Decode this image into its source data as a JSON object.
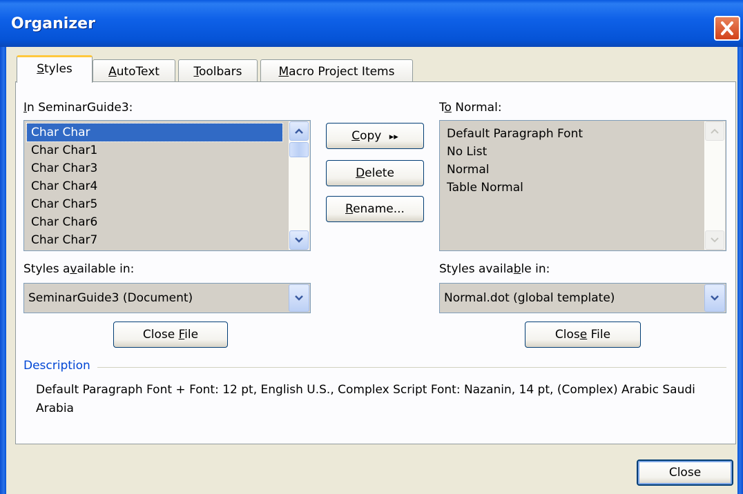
{
  "window": {
    "title": "Organizer"
  },
  "tabs": [
    {
      "pre": "",
      "mn": "S",
      "post": "tyles"
    },
    {
      "pre": "",
      "mn": "A",
      "post": "utoText"
    },
    {
      "pre": "",
      "mn": "T",
      "post": "oolbars"
    },
    {
      "pre": "",
      "mn": "M",
      "post": "acro Project Items"
    }
  ],
  "left": {
    "label": {
      "pre": "",
      "mn": "I",
      "post": "n SeminarGuide3:"
    },
    "items": [
      "Char Char",
      "Char Char1",
      "Char Char3",
      "Char Char4",
      "Char Char5",
      "Char Char6",
      "Char Char7"
    ],
    "selected_item": "Char Char",
    "avail_label": {
      "pre": "Styles a",
      "mn": "v",
      "post": "ailable in:"
    },
    "avail_value": "SeminarGuide3 (Document)",
    "close_file": {
      "pre": "Close ",
      "mn": "F",
      "post": "ile"
    }
  },
  "right": {
    "label": {
      "pre": "T",
      "mn": "o",
      "post": " Normal:"
    },
    "items": [
      "Default Paragraph Font",
      "No List",
      "Normal",
      "Table Normal"
    ],
    "avail_label": {
      "pre": "Styles availa",
      "mn": "b",
      "post": "le in:"
    },
    "avail_value": "Normal.dot (global template)",
    "close_file": {
      "pre": "Clos",
      "mn": "e",
      "post": " File"
    }
  },
  "actions": {
    "copy": {
      "pre": "",
      "mn": "C",
      "post": "opy"
    },
    "copy_arrows": "▸▸",
    "delete": {
      "pre": "",
      "mn": "D",
      "post": "elete"
    },
    "rename": {
      "pre": "",
      "mn": "R",
      "post": "ename..."
    }
  },
  "description": {
    "legend": "Description",
    "text": "Default Paragraph Font + Font: 12 pt, English U.S., Complex Script Font: Nazanin, 14 pt, (Complex) Arabic Saudi Arabia"
  },
  "close_button": "Close",
  "colors": {
    "titlebar": "#0553d6",
    "selection": "#316ac5",
    "dialog_bg": "#ece9d8",
    "description_legend": "#0046d5"
  }
}
